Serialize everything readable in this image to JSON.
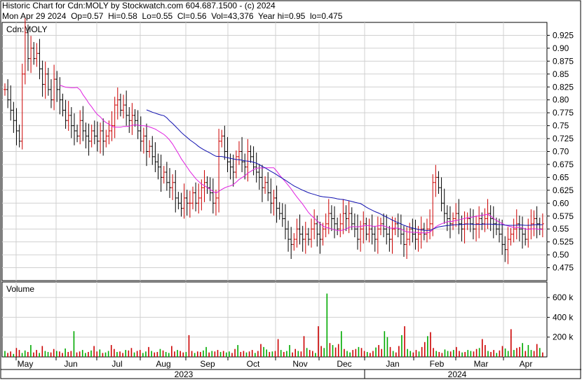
{
  "header": {
    "line1": "Historic Chart for Cdn:MOLY by Stockwatch.com 604.687.1500 - (c) 2024",
    "line2": "Mon Apr 29 2024  Op=0.57  Hi=0.58  Lo=0.55  Cl=0.56  Vol=43,376  Year hi=0.95  lo=0.475"
  },
  "colors": {
    "up": "#cc0000",
    "down": "#000000",
    "ma_short": "#e020e0",
    "ma_long": "#1010b0",
    "volume_up": "#cc0000",
    "volume_down": "#00aa00",
    "grid": "#d0d0d0"
  },
  "chart_data": [
    {
      "type": "line",
      "title": "Cdn:MOLY",
      "ylim": [
        0.45,
        0.95
      ],
      "yticks": [
        "0.925",
        "0.90",
        "0.875",
        "0.85",
        "0.825",
        "0.80",
        "0.775",
        "0.75",
        "0.725",
        "0.70",
        "0.675",
        "0.65",
        "0.625",
        "0.60",
        "0.575",
        "0.55",
        "0.525",
        "0.50",
        "0.475"
      ],
      "x_month_labels": [
        "May",
        "Jun",
        "Jul",
        "Aug",
        "Sep",
        "Oct",
        "Nov",
        "Dec",
        "Jan",
        "Feb",
        "Mar",
        "Apr"
      ],
      "x_year_labels": [
        "2023",
        "2024"
      ],
      "series": [
        {
          "style": "ohlc-bars",
          "close": [
            0.82,
            0.8,
            0.78,
            0.76,
            0.74,
            0.72,
            0.85,
            0.93,
            0.88,
            0.9,
            0.88,
            0.89,
            0.86,
            0.83,
            0.85,
            0.82,
            0.8,
            0.84,
            0.82,
            0.8,
            0.78,
            0.76,
            0.77,
            0.75,
            0.74,
            0.73,
            0.76,
            0.74,
            0.73,
            0.72,
            0.74,
            0.73,
            0.72,
            0.74,
            0.72,
            0.73,
            0.74,
            0.75,
            0.79,
            0.8,
            0.78,
            0.79,
            0.77,
            0.76,
            0.77,
            0.76,
            0.74,
            0.72,
            0.73,
            0.7,
            0.71,
            0.69,
            0.68,
            0.67,
            0.65,
            0.66,
            0.64,
            0.63,
            0.64,
            0.61,
            0.6,
            0.59,
            0.61,
            0.6,
            0.6,
            0.62,
            0.6,
            0.61,
            0.63,
            0.64,
            0.63,
            0.62,
            0.6,
            0.61,
            0.72,
            0.73,
            0.7,
            0.68,
            0.67,
            0.66,
            0.69,
            0.7,
            0.68,
            0.67,
            0.7,
            0.69,
            0.67,
            0.66,
            0.65,
            0.63,
            0.64,
            0.62,
            0.6,
            0.61,
            0.59,
            0.58,
            0.57,
            0.55,
            0.53,
            0.52,
            0.53,
            0.55,
            0.54,
            0.53,
            0.54,
            0.53,
            0.55,
            0.56,
            0.54,
            0.53,
            0.55,
            0.56,
            0.58,
            0.57,
            0.56,
            0.55,
            0.56,
            0.58,
            0.57,
            0.58,
            0.56,
            0.55,
            0.53,
            0.55,
            0.56,
            0.54,
            0.55,
            0.54,
            0.53,
            0.55,
            0.56,
            0.55,
            0.54,
            0.53,
            0.55,
            0.56,
            0.55,
            0.54,
            0.52,
            0.53,
            0.55,
            0.54,
            0.53,
            0.54,
            0.55,
            0.54,
            0.55,
            0.56,
            0.64,
            0.65,
            0.63,
            0.6,
            0.58,
            0.57,
            0.56,
            0.57,
            0.58,
            0.56,
            0.55,
            0.56,
            0.57,
            0.56,
            0.55,
            0.56,
            0.57,
            0.56,
            0.57,
            0.58,
            0.57,
            0.56,
            0.55,
            0.54,
            0.52,
            0.51,
            0.53,
            0.54,
            0.55,
            0.56,
            0.55,
            0.54,
            0.53,
            0.55,
            0.56,
            0.57,
            0.56,
            0.55,
            0.56
          ]
        },
        {
          "name": "",
          "style": "ma-short"
        },
        {
          "name": "",
          "style": "ma-long"
        }
      ]
    },
    {
      "type": "bar",
      "title": "Volume",
      "yticks": [
        "600 k",
        "400 k",
        "200 k"
      ],
      "ylim": [
        0,
        700
      ],
      "values": [
        60,
        40,
        55,
        30,
        90,
        70,
        40,
        65,
        50,
        120,
        45,
        70,
        40,
        110,
        60,
        50,
        45,
        80,
        60,
        55,
        40,
        85,
        50,
        60,
        260,
        45,
        55,
        70,
        40,
        50,
        65,
        110,
        55,
        75,
        40,
        45,
        60,
        120,
        80,
        50,
        55,
        40,
        70,
        65,
        90,
        45,
        60,
        70,
        40,
        55,
        100,
        60,
        45,
        50,
        80,
        65,
        50,
        40,
        110,
        55,
        70,
        60,
        45,
        50,
        220,
        60,
        40,
        55,
        50,
        65,
        100,
        45,
        60,
        55,
        70,
        50,
        60,
        45,
        55,
        40,
        80,
        120,
        50,
        60,
        45,
        55,
        70,
        40,
        60,
        130,
        100,
        75,
        50,
        55,
        60,
        180,
        70,
        50,
        60,
        120,
        45,
        80,
        60,
        55,
        210,
        90,
        70,
        60,
        40,
        310,
        110,
        90,
        640,
        140,
        120,
        95,
        130,
        260,
        80,
        60,
        45,
        70,
        80,
        100,
        90,
        60,
        50,
        40,
        60,
        95,
        120,
        80,
        260,
        200,
        100,
        60,
        45,
        110,
        220,
        310,
        80,
        60,
        45,
        70,
        55,
        100,
        150,
        210,
        250,
        90,
        60,
        50,
        40,
        75,
        60,
        55,
        70,
        100,
        60,
        45,
        50,
        70,
        60,
        55,
        80,
        90,
        180,
        120,
        60,
        50,
        70,
        40,
        65,
        110,
        85,
        60,
        280,
        70,
        90,
        100,
        140,
        60,
        120,
        70,
        60,
        130,
        90,
        45
      ]
    }
  ]
}
